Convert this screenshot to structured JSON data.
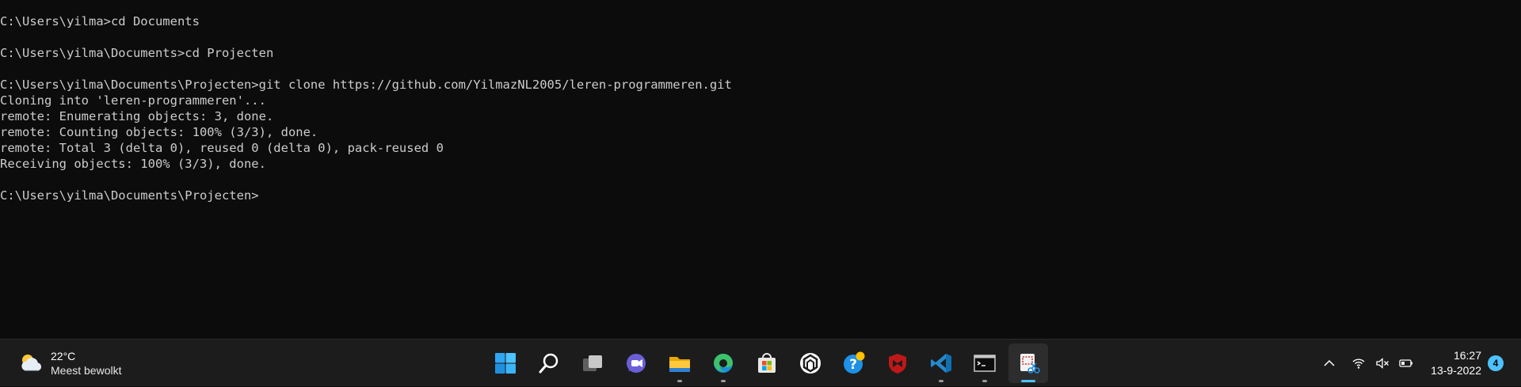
{
  "terminal": {
    "lines": [
      "C:\\Users\\yilma>cd Documents",
      "",
      "C:\\Users\\yilma\\Documents>cd Projecten",
      "",
      "C:\\Users\\yilma\\Documents\\Projecten>git clone https://github.com/YilmazNL2005/leren-programmeren.git",
      "Cloning into 'leren-programmeren'...",
      "remote: Enumerating objects: 3, done.",
      "remote: Counting objects: 100% (3/3), done.",
      "remote: Total 3 (delta 0), reused 0 (delta 0), pack-reused 0",
      "Receiving objects: 100% (3/3), done.",
      "",
      "C:\\Users\\yilma\\Documents\\Projecten>"
    ]
  },
  "taskbar": {
    "weather": {
      "temperature": "22°C",
      "description": "Meest bewolkt",
      "icon": "partly-cloudy-icon"
    },
    "apps": [
      {
        "name": "start",
        "icon": "windows-logo-icon",
        "running": false,
        "active": false
      },
      {
        "name": "search",
        "icon": "search-icon",
        "running": false,
        "active": false
      },
      {
        "name": "task-view",
        "icon": "task-view-icon",
        "running": false,
        "active": false
      },
      {
        "name": "chat",
        "icon": "chat-icon",
        "running": false,
        "active": false
      },
      {
        "name": "file-explorer",
        "icon": "folder-icon",
        "running": true,
        "active": false
      },
      {
        "name": "edge",
        "icon": "edge-icon",
        "running": true,
        "active": false
      },
      {
        "name": "store",
        "icon": "store-icon",
        "running": false,
        "active": false
      },
      {
        "name": "app-hex",
        "icon": "hexagon-app-icon",
        "running": false,
        "active": false
      },
      {
        "name": "help",
        "icon": "help-icon",
        "running": false,
        "active": false
      },
      {
        "name": "mcafee",
        "icon": "mcafee-icon",
        "running": false,
        "active": false
      },
      {
        "name": "vscode",
        "icon": "vscode-icon",
        "running": true,
        "active": false
      },
      {
        "name": "terminal",
        "icon": "terminal-icon",
        "running": true,
        "active": false
      },
      {
        "name": "snipping-tool",
        "icon": "snipping-tool-icon",
        "running": true,
        "active": true
      }
    ],
    "tray": {
      "icons": [
        "chevron-up-icon",
        "wifi-icon",
        "volume-muted-icon",
        "battery-icon"
      ],
      "time": "16:27",
      "date": "13-9-2022",
      "notification_count": "4"
    },
    "colors": {
      "accent": "#4cc2ff",
      "taskbar_bg": "#1c1c1c",
      "terminal_bg": "#0c0c0c",
      "terminal_fg": "#cccccc"
    }
  }
}
